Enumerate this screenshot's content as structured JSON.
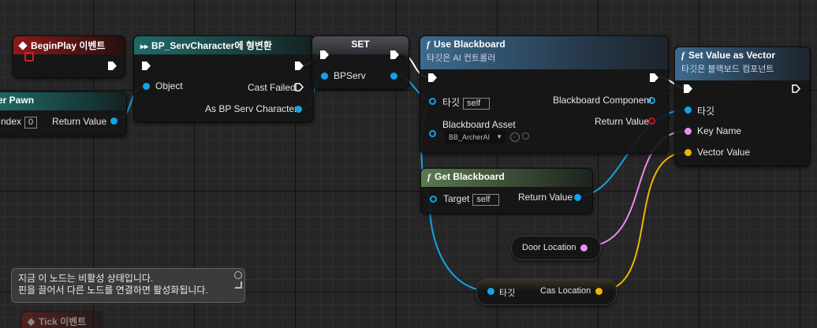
{
  "nodes": {
    "begin_play": {
      "title": "BeginPlay 이벤트"
    },
    "pawn": {
      "title": "er Pawn",
      "index_label": "ndex",
      "index_value": "0",
      "return_label": "Return Value"
    },
    "cast": {
      "title": "BP_ServCharacter에 형변환",
      "object_label": "Object",
      "cast_failed_label": "Cast Failed",
      "as_label": "As BP Serv Character"
    },
    "set": {
      "title": "SET",
      "var_label": "BPServ"
    },
    "use_blackboard": {
      "title": "Use Blackboard",
      "subtitle": "타깃은 AI 컨트롤러",
      "target_label": "타깃",
      "target_value": "self",
      "asset_label": "Blackboard Asset",
      "asset_value": "BB_ArcherAI",
      "component_label": "Blackboard Component",
      "return_label": "Return Value"
    },
    "get_blackboard": {
      "title": "Get Blackboard",
      "target_label": "Target",
      "target_value": "self",
      "return_label": "Return Value"
    },
    "set_value_vector": {
      "title": "Set Value as Vector",
      "subtitle": "타깃은 블랙보드 컴포넌트",
      "target_label": "타깃",
      "key_label": "Key Name",
      "vector_label": "Vector Value"
    },
    "door_location": {
      "label": "Door Location"
    },
    "cas_location": {
      "target_label": "타깃",
      "label": "Cas Location"
    },
    "tick": {
      "title": "Tick 이벤트"
    }
  },
  "tooltip": {
    "line1": "지금 이 노드는 비활성 상태입니다.",
    "line2": "핀을 끌어서 다른 노드를 연결하면 활성화됩니다."
  },
  "colors": {
    "exec": "#ffffff",
    "object": "#13a3e6",
    "name": "#e88cf0",
    "vector": "#f0b400",
    "event": "#8d1a1a"
  }
}
